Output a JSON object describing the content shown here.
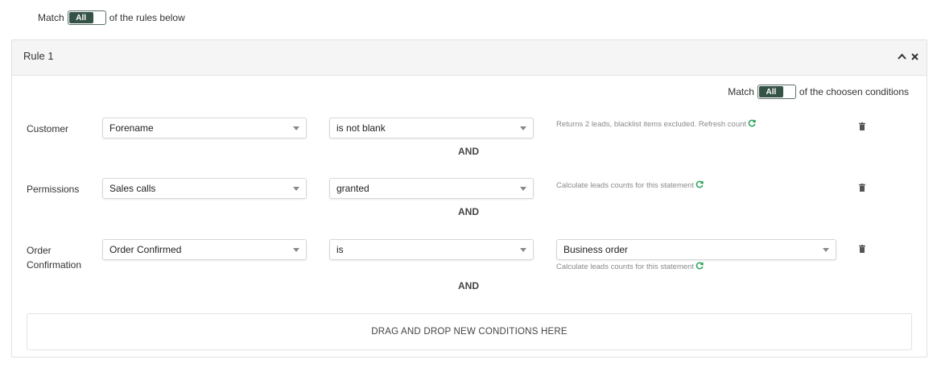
{
  "top_match": {
    "prefix": "Match",
    "toggle_label": "All",
    "suffix": "of the rules below"
  },
  "rule": {
    "title": "Rule 1",
    "collapse_icon": "^",
    "close_icon": "×",
    "match": {
      "prefix": "Match",
      "toggle_label": "All",
      "suffix": "of the choosen conditions"
    },
    "conditions": [
      {
        "label_lines": [
          "Customer"
        ],
        "field": "Forename",
        "operator": "is not blank",
        "value": "",
        "hint": "Returns 2 leads, blacklist items excluded. Refresh count",
        "connector": "AND"
      },
      {
        "label_lines": [
          "Permissions"
        ],
        "field": "Sales calls",
        "operator": "granted",
        "value": "",
        "hint": "Calculate leads counts for this statement",
        "connector": "AND"
      },
      {
        "label_lines": [
          "Order",
          "Confirmation"
        ],
        "field": "Order Confirmed",
        "operator": "is",
        "value": "Business order",
        "hint": "Calculate leads counts for this statement",
        "connector": "AND"
      }
    ],
    "dropzone": "DRAG AND DROP NEW CONDITIONS HERE"
  },
  "icons": {
    "refresh": "refresh-icon",
    "trash": "trash-icon",
    "caret": "chevron-down-icon"
  },
  "colors": {
    "toggle_on": "#355247",
    "refresh": "#2aa35a",
    "header_bg": "#f5f5f5",
    "border": "#e2e2e2"
  }
}
